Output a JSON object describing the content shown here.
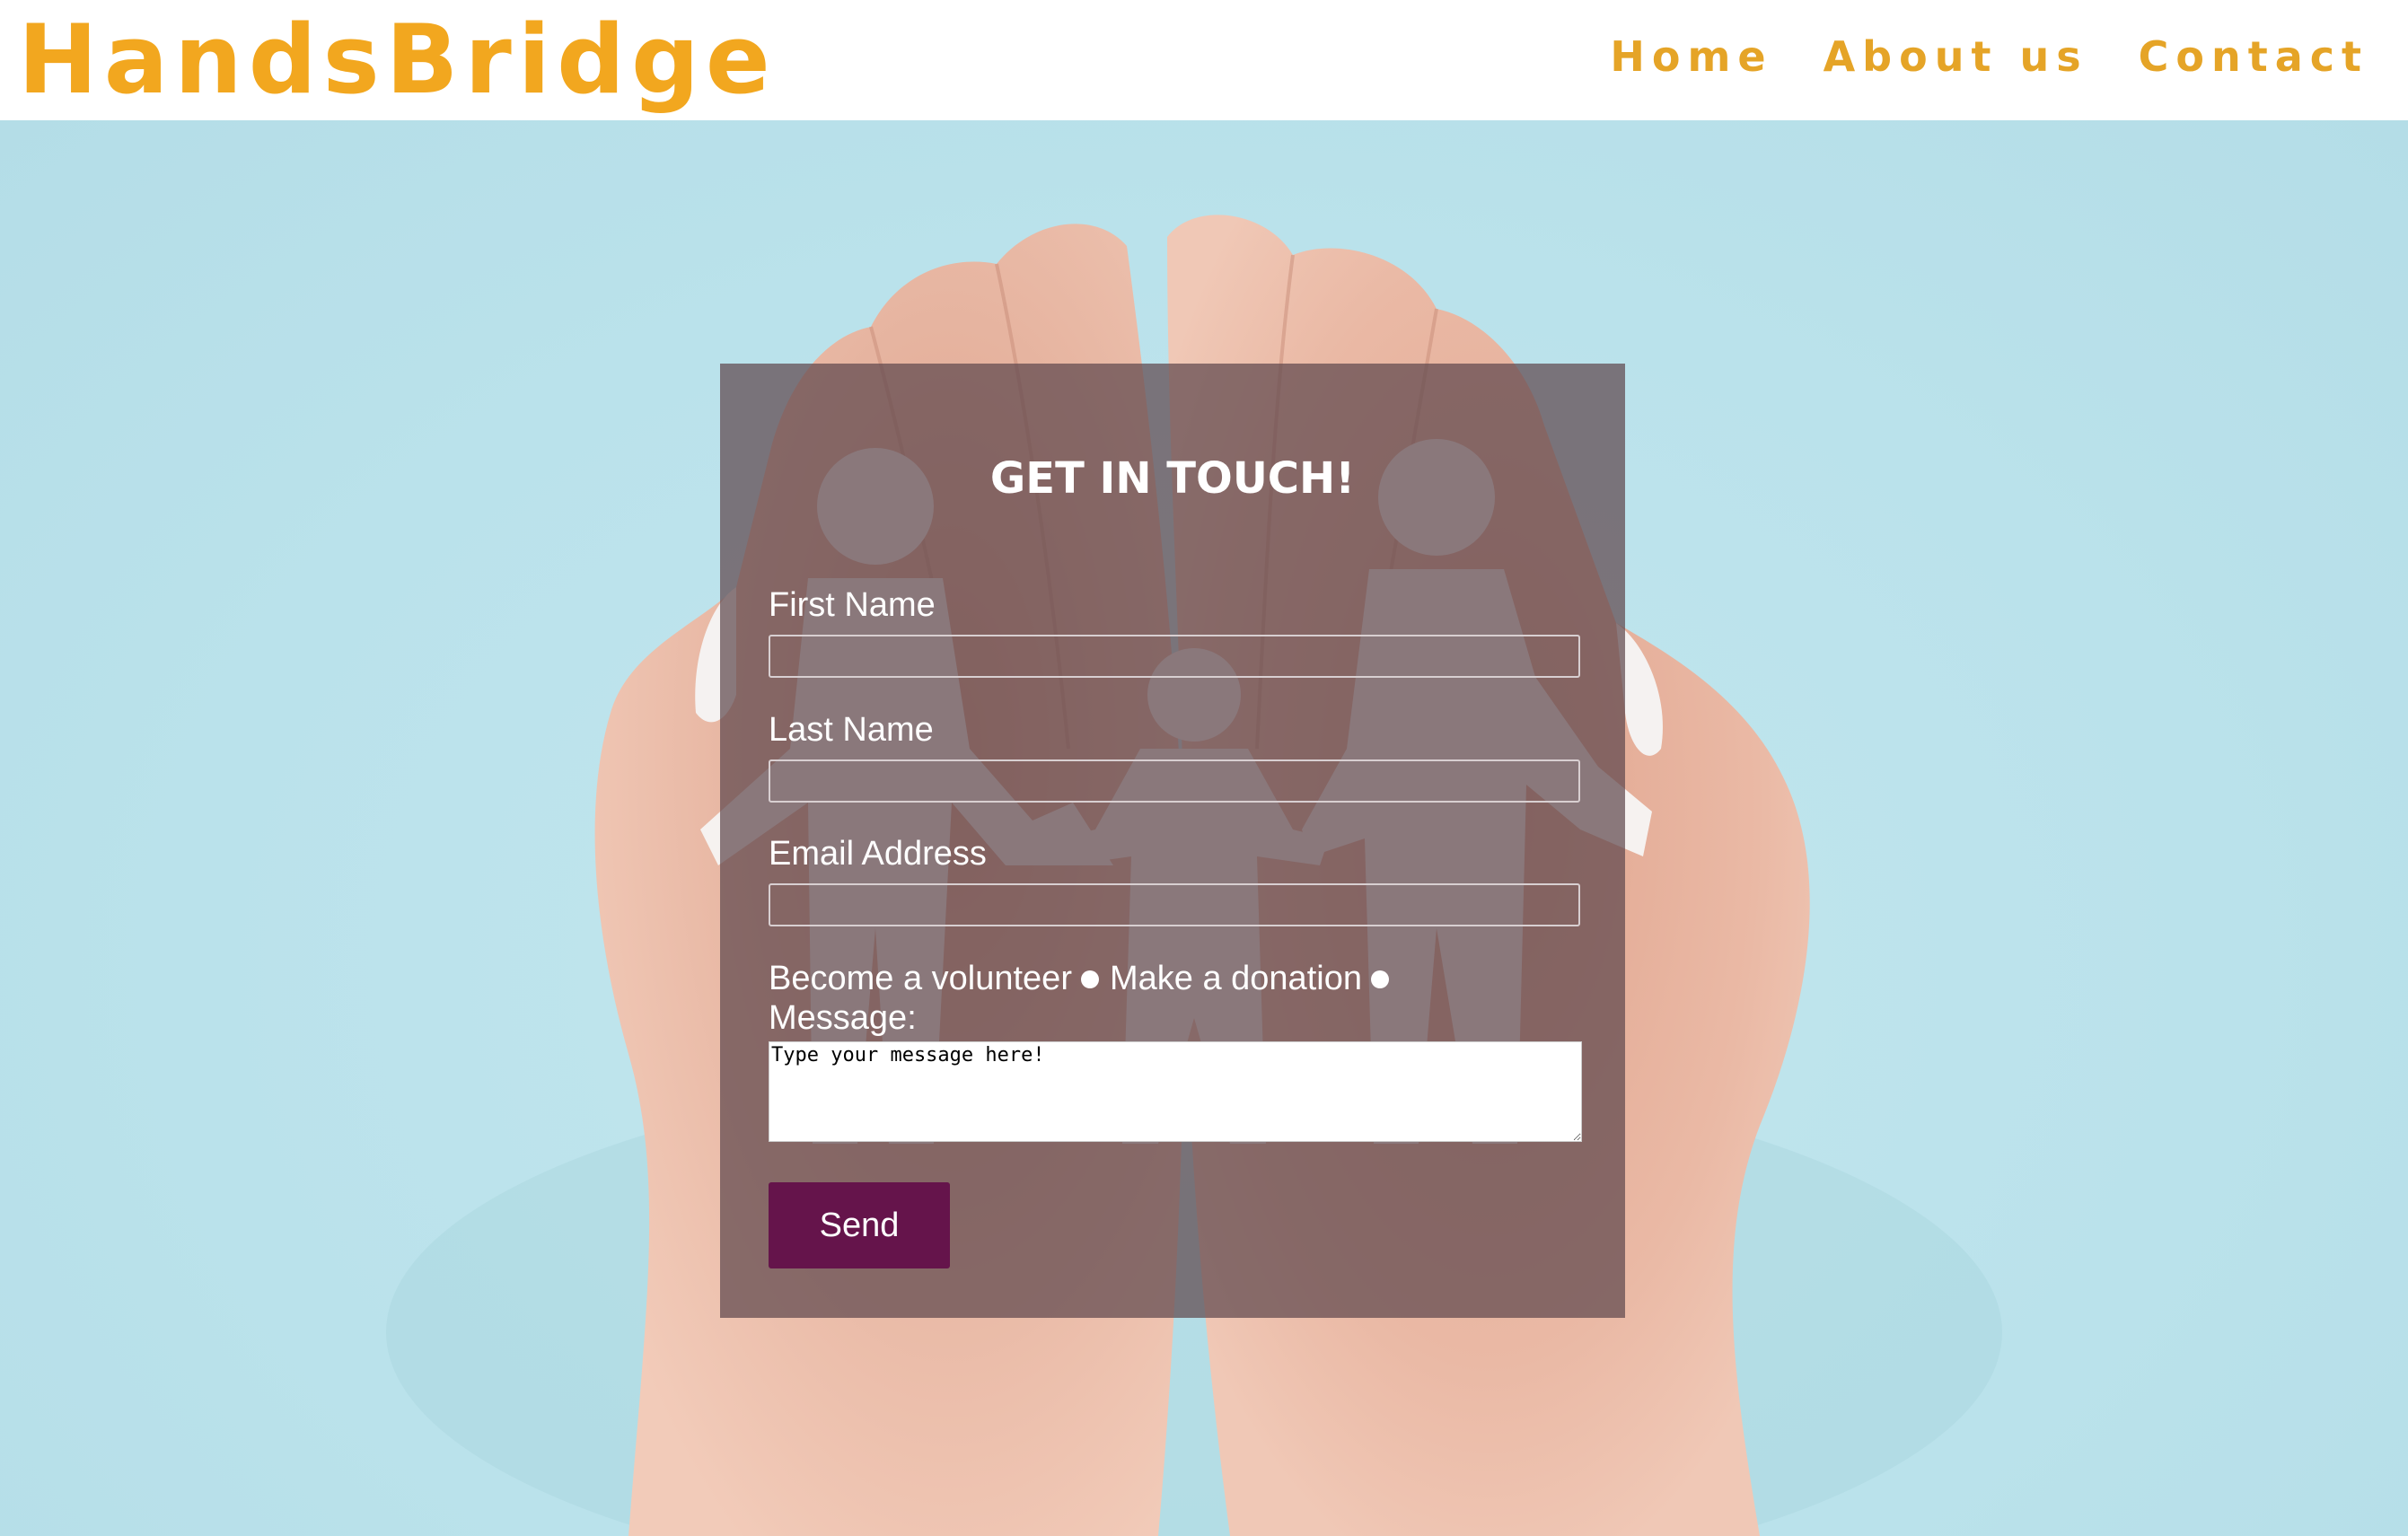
{
  "header": {
    "brand": "HandsBridge",
    "nav": [
      {
        "label": "Home"
      },
      {
        "label": "About us"
      },
      {
        "label": "Contact"
      }
    ]
  },
  "contact_form": {
    "title": "GET IN TOUCH!",
    "fields": {
      "first_name": {
        "label": "First Name",
        "value": ""
      },
      "last_name": {
        "label": "Last Name",
        "value": ""
      },
      "email": {
        "label": "Email Address",
        "value": ""
      }
    },
    "options": {
      "volunteer_label": "Become a volunteer",
      "donation_label": "Make a donation"
    },
    "message": {
      "label": "Message:",
      "value": "Type your message here!"
    },
    "send_label": "Send"
  },
  "colors": {
    "brand": "#f2a71f",
    "nav": "#e5a427",
    "background": "#bde3ec",
    "panel": "#60484e",
    "button": "#65144b"
  }
}
